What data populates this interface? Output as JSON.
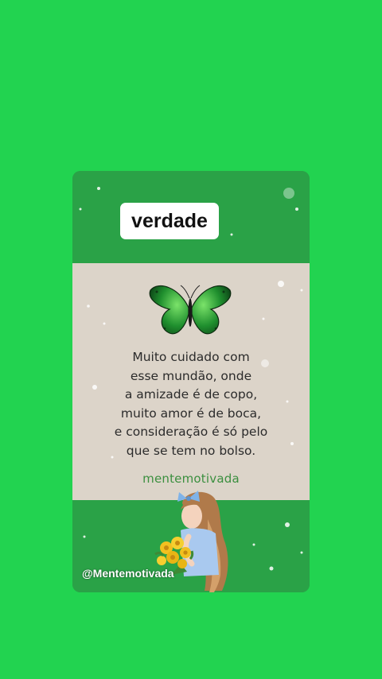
{
  "card": {
    "tag_label": "verdade",
    "quote_lines": [
      "Muito cuidado com",
      "esse mundão, onde",
      "a amizade é de copo,",
      "muito amor é de boca,",
      "e consideração é só pelo",
      "que se tem no bolso."
    ],
    "signature": "mentemotivada",
    "handle": "@Mentemotivada"
  },
  "colors": {
    "background": "#22d350",
    "card_green": "#2aa247",
    "card_beige": "#dcd4c9",
    "signature_green": "#3b8f3f"
  },
  "icons": {
    "butterfly": "green-butterfly-icon",
    "illustration": "girl-with-flowers-illustration"
  }
}
